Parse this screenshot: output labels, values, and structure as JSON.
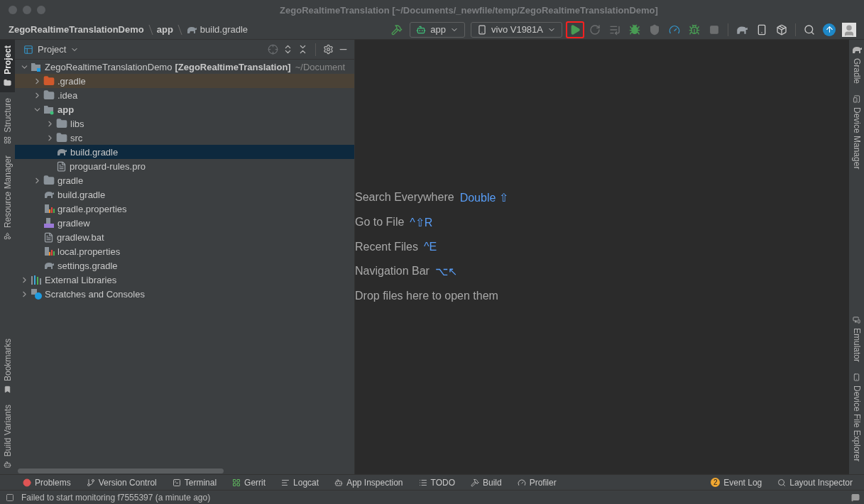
{
  "window": {
    "title": "ZegoRealtimeTranslation [~/Documents/_newfile/temp/ZegoRealtimeTranslationDemo]"
  },
  "breadcrumbs": [
    {
      "label": "ZegoRealtimeTranslationDemo",
      "kind": "project"
    },
    {
      "label": "app",
      "kind": "module"
    },
    {
      "label": "build.gradle",
      "kind": "gradle"
    }
  ],
  "toolbar": {
    "config": {
      "label": "app"
    },
    "device": {
      "label": "vivo V1981A"
    },
    "actions": [
      {
        "kind": "run",
        "disabled": false,
        "highlighted": true
      },
      {
        "kind": "rerun",
        "disabled": true,
        "highlighted": false
      },
      {
        "kind": "apply",
        "disabled": true,
        "highlighted": false
      },
      {
        "kind": "debug",
        "disabled": false,
        "highlighted": false
      },
      {
        "kind": "coverage",
        "disabled": true,
        "highlighted": false
      },
      {
        "kind": "profile",
        "disabled": false,
        "highlighted": false
      },
      {
        "kind": "attach",
        "disabled": false,
        "highlighted": false
      },
      {
        "kind": "stop",
        "disabled": true,
        "highlighted": false
      },
      {
        "kind": "sync",
        "disabled": false,
        "highlighted": false
      },
      {
        "kind": "devices",
        "disabled": false,
        "highlighted": false
      },
      {
        "kind": "sdk",
        "disabled": false,
        "highlighted": false
      },
      {
        "kind": "search",
        "disabled": false,
        "highlighted": false
      },
      {
        "kind": "update",
        "disabled": false,
        "highlighted": false
      },
      {
        "kind": "account",
        "disabled": false,
        "highlighted": false
      }
    ]
  },
  "left_strip": {
    "top": [
      {
        "label": "Project",
        "selected": true,
        "kind": "folder"
      },
      {
        "label": "Structure",
        "selected": false,
        "kind": "structure"
      },
      {
        "label": "Resource Manager",
        "selected": false,
        "kind": "resources"
      }
    ],
    "bottom": [
      {
        "label": "Bookmarks",
        "selected": false,
        "kind": "bookmark"
      },
      {
        "label": "Build Variants",
        "selected": false,
        "kind": "android"
      }
    ]
  },
  "right_strip": {
    "top": [
      {
        "label": "Gradle",
        "kind": "gradle"
      },
      {
        "label": "Device Manager",
        "kind": "devices"
      }
    ],
    "bottom": [
      {
        "label": "Emulator",
        "kind": "emulator"
      },
      {
        "label": "Device File Explorer",
        "kind": "phone"
      }
    ]
  },
  "project_panel": {
    "title": "Project",
    "tree": [
      {
        "kind": "project",
        "name": "ZegoRealtimeTranslationDemo",
        "module": "[ZegoRealtimeTranslation]",
        "path": "~/Document",
        "expanded": true,
        "selected": false,
        "children": [
          {
            "kind": "excluded-folder",
            "name": ".gradle",
            "expanded": false,
            "selected": false
          },
          {
            "kind": "folder",
            "name": ".idea",
            "expanded": false,
            "selected": false
          },
          {
            "kind": "module",
            "name": "app",
            "expanded": true,
            "selected": false,
            "children": [
              {
                "kind": "folder",
                "name": "libs",
                "expanded": false,
                "selected": false
              },
              {
                "kind": "folder",
                "name": "src",
                "expanded": false,
                "selected": false
              },
              {
                "kind": "gradle",
                "name": "build.gradle",
                "selected": true
              },
              {
                "kind": "text",
                "name": "proguard-rules.pro",
                "selected": false
              }
            ]
          },
          {
            "kind": "folder",
            "name": "gradle",
            "expanded": false,
            "selected": false
          },
          {
            "kind": "gradle",
            "name": "build.gradle",
            "selected": false
          },
          {
            "kind": "properties",
            "name": "gradle.properties",
            "selected": false
          },
          {
            "kind": "script",
            "name": "gradlew",
            "selected": false
          },
          {
            "kind": "text",
            "name": "gradlew.bat",
            "selected": false
          },
          {
            "kind": "properties",
            "name": "local.properties",
            "selected": false
          },
          {
            "kind": "gradle",
            "name": "settings.gradle",
            "selected": false
          }
        ]
      },
      {
        "kind": "libraries",
        "name": "External Libraries",
        "expanded": false,
        "selected": false
      },
      {
        "kind": "scratches",
        "name": "Scratches and Consoles",
        "expanded": false,
        "selected": false
      }
    ]
  },
  "editor": {
    "hints": [
      {
        "label": "Search Everywhere",
        "shortcut": "Double ⇧"
      },
      {
        "label": "Go to File",
        "shortcut": "^⇧R"
      },
      {
        "label": "Recent Files",
        "shortcut": "^E"
      },
      {
        "label": "Navigation Bar",
        "shortcut": "⌥↖"
      },
      {
        "label": "Drop files here to open them"
      }
    ]
  },
  "tool_windows": {
    "left": [
      {
        "label": "Problems",
        "kind": "problems"
      },
      {
        "label": "Version Control",
        "kind": "vcs"
      },
      {
        "label": "Terminal",
        "kind": "terminal"
      },
      {
        "label": "Gerrit",
        "kind": "gerrit"
      },
      {
        "label": "Logcat",
        "kind": "logcat"
      },
      {
        "label": "App Inspection",
        "kind": "inspection"
      },
      {
        "label": "TODO",
        "kind": "todo"
      },
      {
        "label": "Build",
        "kind": "build"
      },
      {
        "label": "Profiler",
        "kind": "profiler"
      }
    ],
    "right": [
      {
        "label": "Event Log",
        "kind": "events",
        "badge": "2"
      },
      {
        "label": "Layout Inspector",
        "kind": "layout"
      }
    ]
  },
  "status_bar": {
    "message": "Failed to start monitoring f7555397 (a minute ago)"
  }
}
